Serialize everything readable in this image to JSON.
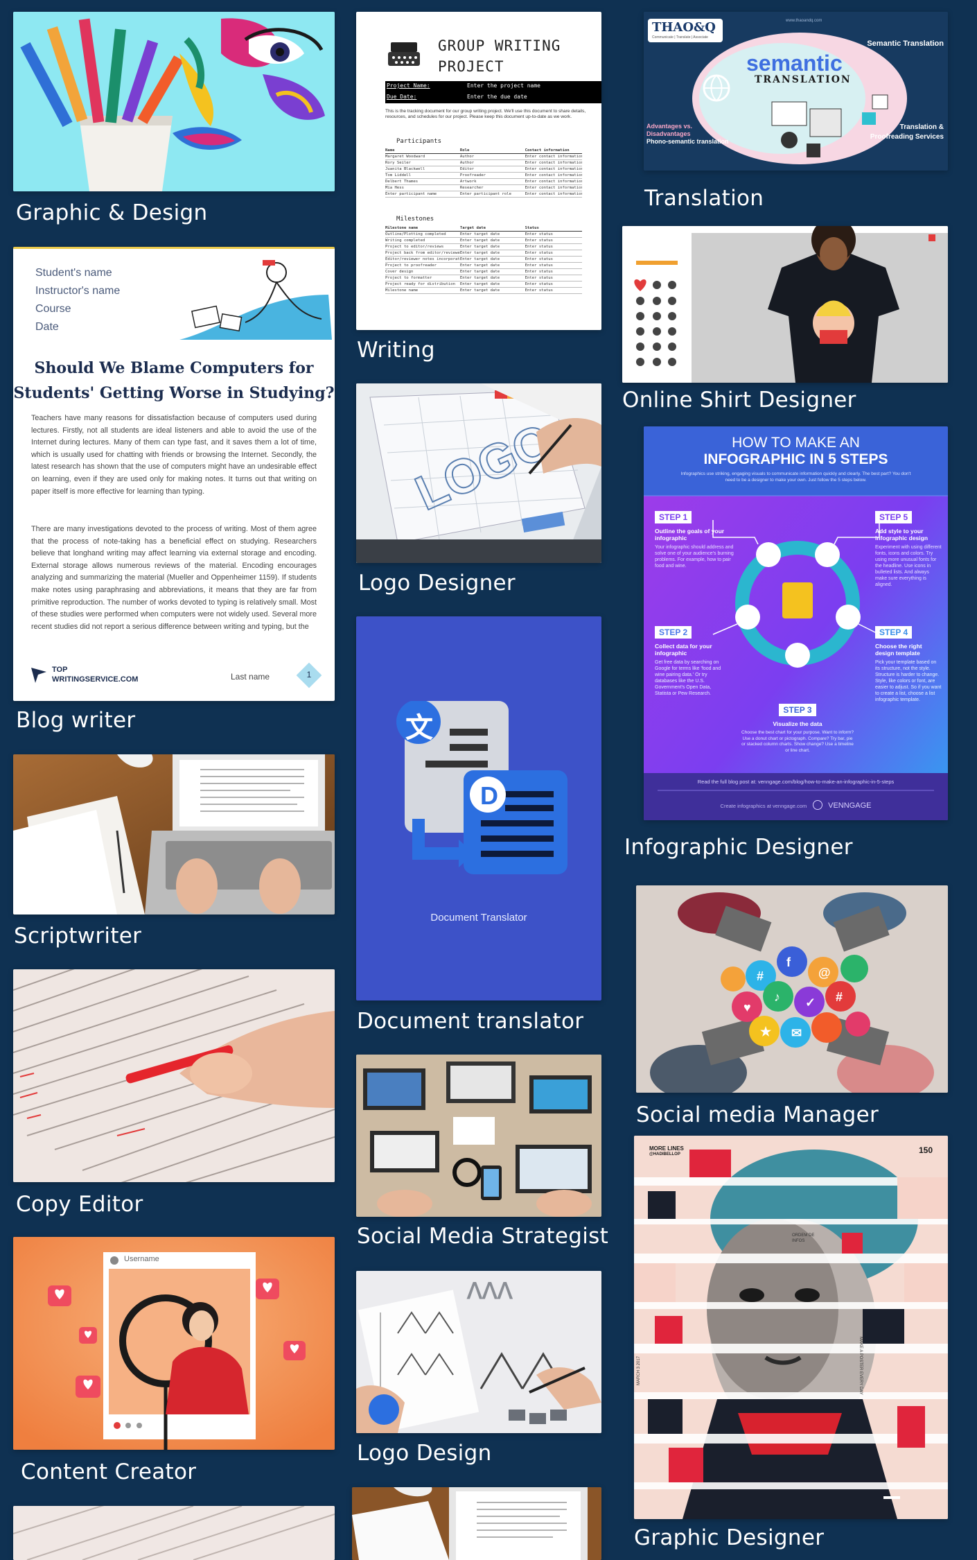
{
  "captions": {
    "graphic_design": "Graphic & Design",
    "blog_writer": "Blog writer",
    "scriptwriter": "Scriptwriter",
    "copy_editor": "Copy Editor",
    "content_creator": "Content Creator",
    "writing": "Writing",
    "logo_designer": "Logo Designer",
    "document_translator": "Document translator",
    "social_media_strategist": "Social Media Strategist",
    "logo_design": "Logo Design",
    "translation": "Translation",
    "online_shirt_designer": "Online Shirt Designer",
    "infographic_designer": "Infographic Designer",
    "social_media_manager": "Social media Manager",
    "graphic_designer": "Graphic Designer"
  },
  "blog": {
    "meta_lines": [
      "Student's name",
      "Instructor's name",
      "Course",
      "Date"
    ],
    "title_line1": "Should We Blame Computers for",
    "title_line2": "Students' Getting Worse in Studying?",
    "paragraph1": "Teachers have many reasons for dissatisfaction because of computers used during lectures. Firstly, not all students are ideal listeners and able to avoid the use of the Internet during lectures. Many of them can type fast, and it saves them a lot of time, which is usually used for chatting with friends or browsing the Internet. Secondly, the latest research has shown that the use of computers might have an undesirable effect on learning, even if they are used only for making notes. It turns out that writing on paper itself is more effective for learning than typing.",
    "paragraph2": "There are many investigations devoted to the process of writing. Most of them agree that the process of note-taking has a beneficial effect on studying. Researchers believe that longhand writing may affect learning via external storage and encoding. External storage allows numerous reviews of the material. Encoding encourages analyzing and summarizing the material (Mueller and Oppenheimer 1159). If students make notes using paraphrasing and abbreviations, it means that they are far from primitive reproduction. The number of works devoted to typing is relatively small. Most of these studies were performed when computers were not widely used. Several more recent studies did not report a serious difference between writing and typing, but the",
    "brand_line1": "TOP",
    "brand_line2": "WRITINGSERVICE.COM",
    "footer_name": "Last name",
    "page_number": "1"
  },
  "writing_doc": {
    "title_line1": "GROUP WRITING",
    "title_line2": "PROJECT",
    "field1_label": "Project Name:",
    "field1_value": "Enter the project name",
    "field2_label": "Due Date:",
    "field2_value": "Enter the due date",
    "intro": "This is the tracking document for our group writing project. We'll use this document to share details, resources, and schedules for our project. Please keep this document up-to-date as we work.",
    "participants_heading": "Participants",
    "participants_columns": [
      "Name",
      "Role",
      "Contact information"
    ],
    "participants_rows": [
      [
        "Margaret Woodward",
        "Author",
        "Enter contact information"
      ],
      [
        "Rory Seiler",
        "Author",
        "Enter contact information"
      ],
      [
        "Juanita Blackwell",
        "Editor",
        "Enter contact information"
      ],
      [
        "Tom Liddell",
        "Proofreader",
        "Enter contact information"
      ],
      [
        "Delbert Thames",
        "Artwork",
        "Enter contact information"
      ],
      [
        "Mia Hess",
        "Researcher",
        "Enter contact information"
      ],
      [
        "Enter participant name",
        "Enter participant role",
        "Enter contact information"
      ]
    ],
    "milestones_heading": "Milestones",
    "milestones_columns": [
      "Milestone name",
      "Target date",
      "Status"
    ],
    "milestones_rows": [
      [
        "Outline/Plotting completed",
        "Enter target date",
        "Enter status"
      ],
      [
        "Writing completed",
        "Enter target date",
        "Enter status"
      ],
      [
        "Project to editor/reviews",
        "Enter target date",
        "Enter status"
      ],
      [
        "Project back from editor/reviewers",
        "Enter target date",
        "Enter status"
      ],
      [
        "Editor/reviewer notes incorporated",
        "Enter target date",
        "Enter status"
      ],
      [
        "Project to proofreader",
        "Enter target date",
        "Enter status"
      ],
      [
        "Cover design",
        "Enter target date",
        "Enter status"
      ],
      [
        "Project to formatter",
        "Enter target date",
        "Enter status"
      ],
      [
        "Project ready for distribution",
        "Enter target date",
        "Enter status"
      ],
      [
        "Milestone name",
        "Enter target date",
        "Enter status"
      ]
    ]
  },
  "logo_sketch": {
    "word": "LOGO"
  },
  "doc_translator": {
    "label": "Document Translator",
    "glyph_source": "文",
    "glyph_target": "D"
  },
  "translation_banner": {
    "brand": "THAO&Q",
    "brand_tagline": "Communicate | Translate | Associate",
    "website": "www.thaoandq.com",
    "corner_title": "Semantic Translation",
    "headline": "semantic",
    "subheadline": "TRANSLATION",
    "left_line1": "Advantages vs.",
    "left_line2": "Disadvantages",
    "left_line3": "Phono-semantic translation",
    "right_line1": "Translation &",
    "right_line2": "Proofreading Services"
  },
  "infographic": {
    "title_line1": "HOW TO MAKE AN",
    "title_line2": "INFOGRAPHIC IN 5 STEPS",
    "intro": "Infographics use striking, engaging visuals to communicate information quickly and clearly. The best part? You don't need to be a designer to make your own. Just follow the 5 steps below.",
    "steps": [
      {
        "label": "STEP 1",
        "heading": "Outline the goals of your infographic",
        "text": "Your infographic should address and solve one of your audience's burning problems. For example, how to pair food and wine."
      },
      {
        "label": "STEP 2",
        "heading": "Collect data for your infographic",
        "text": "Get free data by searching on Google for terms like 'food and wine pairing data.' Or try databases like the U.S. Government's Open Data, Statista or Pew Research."
      },
      {
        "label": "STEP 3",
        "heading": "Visualize the data",
        "text": "Choose the best chart for your purpose. Want to inform? Use a donut chart or pictograph. Compare? Try bar, pie or stacked column charts. Show change? Use a timeline or line chart."
      },
      {
        "label": "STEP 4",
        "heading": "Choose the right design template",
        "text": "Pick your template based on its structure, not the style. Structure is harder to change. Style, like colors or font, are easier to adjust. So if you want to create a list, choose a list infographic template."
      },
      {
        "label": "STEP 5",
        "heading": "Add style to your infographic design",
        "text": "Experiment with using different fonts, icons and colors. Try using more unusual fonts for the headline. Use icons in bulleted lists. And always make sure everything is aligned."
      }
    ],
    "footer_link": "Read the full blog post at: venngage.com/blog/how-to-make-an-infographic-in-5-steps",
    "footer_credit": "Create infographics at venngage.com",
    "footer_brand": "VENNGAGE"
  },
  "poster": {
    "left_header_line1": "MORE LINES",
    "left_header_line2": "@HADIBELLOP",
    "number": "150",
    "side_right": "MAKE A POSTER EVERY DAY",
    "side_left": "MARCH 3 2017",
    "tiny_text": "ORDEM DE INFOS"
  },
  "content_creator": {
    "username": "Username"
  }
}
